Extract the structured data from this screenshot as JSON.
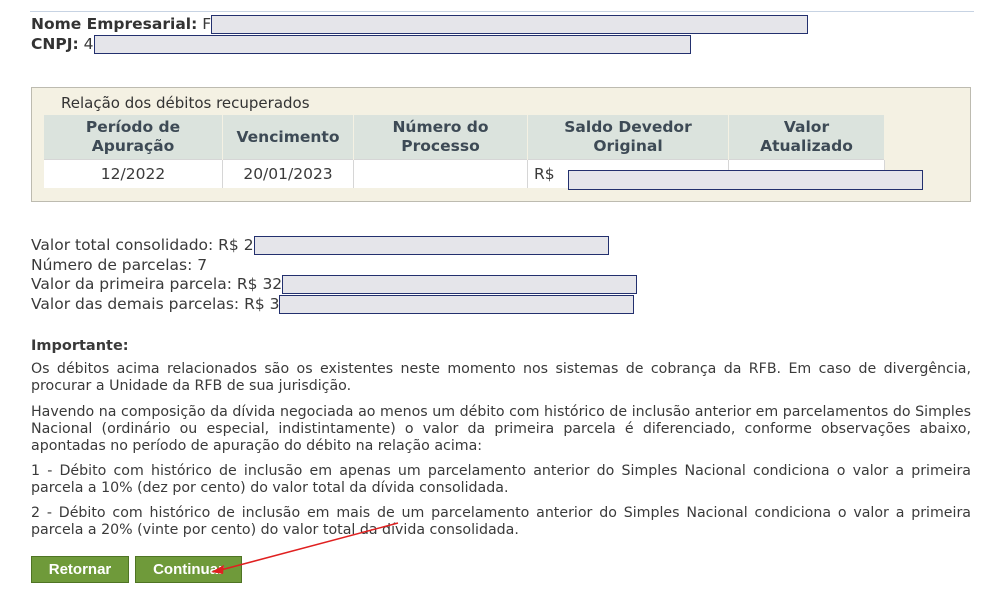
{
  "company": {
    "name_label": "Nome Empresarial:",
    "name_prefix": "F",
    "cnpj_label": "CNPJ:",
    "cnpj_prefix": "4"
  },
  "debts": {
    "title": "Relação dos débitos recuperados",
    "columns": [
      "Período de Apuração",
      "Vencimento",
      "Número do Processo",
      "Saldo Devedor Original",
      "Valor Atualizado"
    ],
    "rows": [
      {
        "periodo": "12/2022",
        "vencimento": "20/01/2023",
        "processo": "",
        "saldo_prefix": "R$"
      }
    ]
  },
  "summary": {
    "total_label": "Valor total consolidado: R$ 2",
    "parcelas_label": "Número de parcelas: 7",
    "primeira_label": "Valor da primeira parcela: R$ 32",
    "demais_label": "Valor das demais parcelas: R$ 3"
  },
  "important": {
    "title": "Importante:",
    "p1": "Os débitos acima relacionados são os existentes neste momento nos sistemas de cobrança da RFB. Em caso de divergência, procurar a Unidade da RFB de sua jurisdição.",
    "p2": "Havendo na composição da dívida negociada ao menos um débito com histórico de inclusão anterior em parcelamentos do Simples Nacional (ordinário ou especial, indistintamente) o valor da primeira parcela é diferenciado, conforme observações abaixo, apontadas no período de apuração do débito na relação acima:",
    "p3": "1 - Débito com histórico de inclusão em apenas um parcelamento anterior do Simples Nacional condiciona o valor a primeira parcela a 10% (dez por cento) do valor total da dívida consolidada.",
    "p4": "2 - Débito com histórico de inclusão em mais de um parcelamento anterior do Simples Nacional condiciona o valor a primeira parcela a 20% (vinte por cento) do valor total da dívida consolidada."
  },
  "buttons": {
    "back": "Retornar",
    "continue": "Continuar"
  },
  "colors": {
    "button": "#6f9a3a",
    "redaction_border": "#23306e",
    "annotation_arrow": "#e02020"
  }
}
